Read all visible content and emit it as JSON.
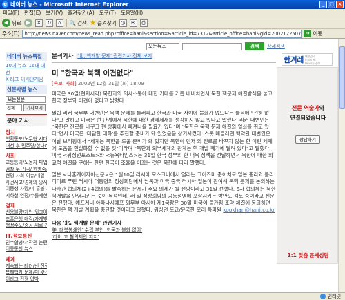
{
  "window": {
    "title": "네이버 뉴스 - Microsoft Internet Explorer",
    "minimize": "_",
    "maximize": "□",
    "close": "×"
  },
  "menu": [
    "파일(F)",
    "편집(E)",
    "보기(V)",
    "즐겨찾기(A)",
    "도구(T)",
    "도움말(H)"
  ],
  "toolbar": {
    "back": "뒤로",
    "search": "검색",
    "favorites": "즐겨찾기"
  },
  "address": {
    "label": "주소(D)",
    "url": "http://news.naver.com/news_read.php?office=hani&section=&article_id=7312&article_office=hani&gid=20021225073340&gno=46667",
    "go": "이동",
    "links": "연결"
  },
  "status": {
    "zone": "인터넷"
  },
  "search": {
    "scope": "모든뉴스",
    "button": "검색",
    "detail_link": "상세검색"
  },
  "sidebar": {
    "head": "네이버 뉴스특집",
    "links": [
      "10대 뉴스",
      "16대 대선",
      "K-리그",
      "아시안게임"
    ],
    "press_head": "신문사별 뉴스",
    "press_select": "모든신문",
    "day_select": "전체",
    "button": "기사보기",
    "section": "분야 기사",
    "categories": [
      {
        "name": "정치",
        "items": [
          "핵확통포/노무현 시대",
          "대선 후 민주당/한나라"
        ]
      },
      {
        "name": "사회",
        "items": [
          "교통통이/노동자 파업",
          "검찰 무 귀국/ 한명숙서",
          "현명 사회 이슈/내일",
          "사건사고/경제의 당사",
          "여중생 사망/미 흉볼 저당",
          "지하철 연장/수를제한"
        ]
      },
      {
        "name": "경제",
        "items": [
          "신용불량/개인 워크아웃",
          "조흥은행 매각/가계빚",
          "행정수도/중공 새로 개시"
        ]
      },
      {
        "name": "IT/정보통신",
        "items": [
          "인수합병/저작권 논란",
          "이동통신 뉴스"
        ]
      },
      {
        "name": "세계",
        "items": [
          "계속되는 테러/빈 전쟁",
          "복해핵카 문제/미 갖선",
          "이라크 전쟁 압박"
        ]
      }
    ]
  },
  "article": {
    "section": "분석기사",
    "tag": "'北, 핵개발 문제' 관련기사 전체 보기",
    "title": "미 \"한국과 북핵 이견없다\"",
    "press": "[속보, 사회]",
    "date": "2002년 12월 31일 (화) 18:09",
    "paragraphs": [
      "미국은 30일(현지시각) 북한과의 의사소통에 대한 기대를 거듭 내비치면서 북한 핵문제 해결방식을 놓고 한국 정부와 이견이 없다고 밝혔다.",
      "필립 리커 국무부 대변인은 북핵 문제를 둘러싸고 한국과 미국 사이에 불화가 없느냐는 물음에 \"전혀 없다\"고 말하고 미국은 현 단계에서 북한에 대한 경제제재를 생각하지 않고 있다고 말했다. 리커 대변인은 \"북한은 진로를 바꾸고 현 상황에서 빠져나올 필요가 있다\"며 \"북한은 북핵 문제 해결의 열쇠를 쥐고 있다\"면서 미국은 '대담한 대화'를 추진할 준비가 돼 있었음을 상기시켰다. 스콧 매클레런 백악관 대변인은 이날 브리핑에서 \"세계는 북한을 도울 준비가 돼 있지만 북한이 먼저 의 진로를 바꾸지 않는 한 이런 체제에 도움을 현실화할 수 없을 것\"이라며 \"북한과 외부세계의 관계는 핵 개발 폐기에 달려 있다\"고 말했다. 미국 <워싱턴포스트>와 <뉴욕타임스>는 31일 한국 정부의 한 대북 정책을 전달하면서 북한에 대한 외교적 해결을 구하는 한편 한국이 조율을 이끄는 것은 북한에 따라 말했다.",
      "일본 <니혼게이자이신문>은 1월10일 러시아 모스크바에서 열리는 고이즈미 준이치로 일본 총리와 블라디미르 푸틴 러시아 대통령의 정상회담에서 남북과 미국·중국·러시아·일본이 참여해 북핵 문제를 논의하는 다자간 협의체(2+4협의)를 발족하는 문제가 주요 의제가 될 전망이라고 31일 전했다. 6자 협의체는 북한 핵개발을 단념시키는 것이 목적인데, 러·일 정상회담의 공동성명에 포함시키는 방안도 검토 중이라고 신문은 전했다. 예프게니 아파나시예프 외무부 아시아 제1국장은 30일 미국이 불가침 조약 체결에 동의하면 북한은 핵 개발 계획을 중단할 것이라고 말했다. 워싱턴 도쿄/윤국한 모래 특파원"
    ],
    "email": "kookhan@hani.co.kr",
    "related_head": "다음 '北, 핵개발 문제' 관련기사",
    "related_items": [
      "美 '대북봉쇄안' 수립 부인 '한국과 불화 없어'",
      "'라이 고 혐의체안 지지'"
    ]
  },
  "right": {
    "logo": "한겨레",
    "logo_sub": "대한민국 Internet Newspaper",
    "ad_line1_red": "전문 역술가",
    "ad_line1_black": "와",
    "ad_line2": "연결되었습니다",
    "ad_button": "상담하기",
    "ad_footer": "1:1 맞춤 운세상담"
  }
}
